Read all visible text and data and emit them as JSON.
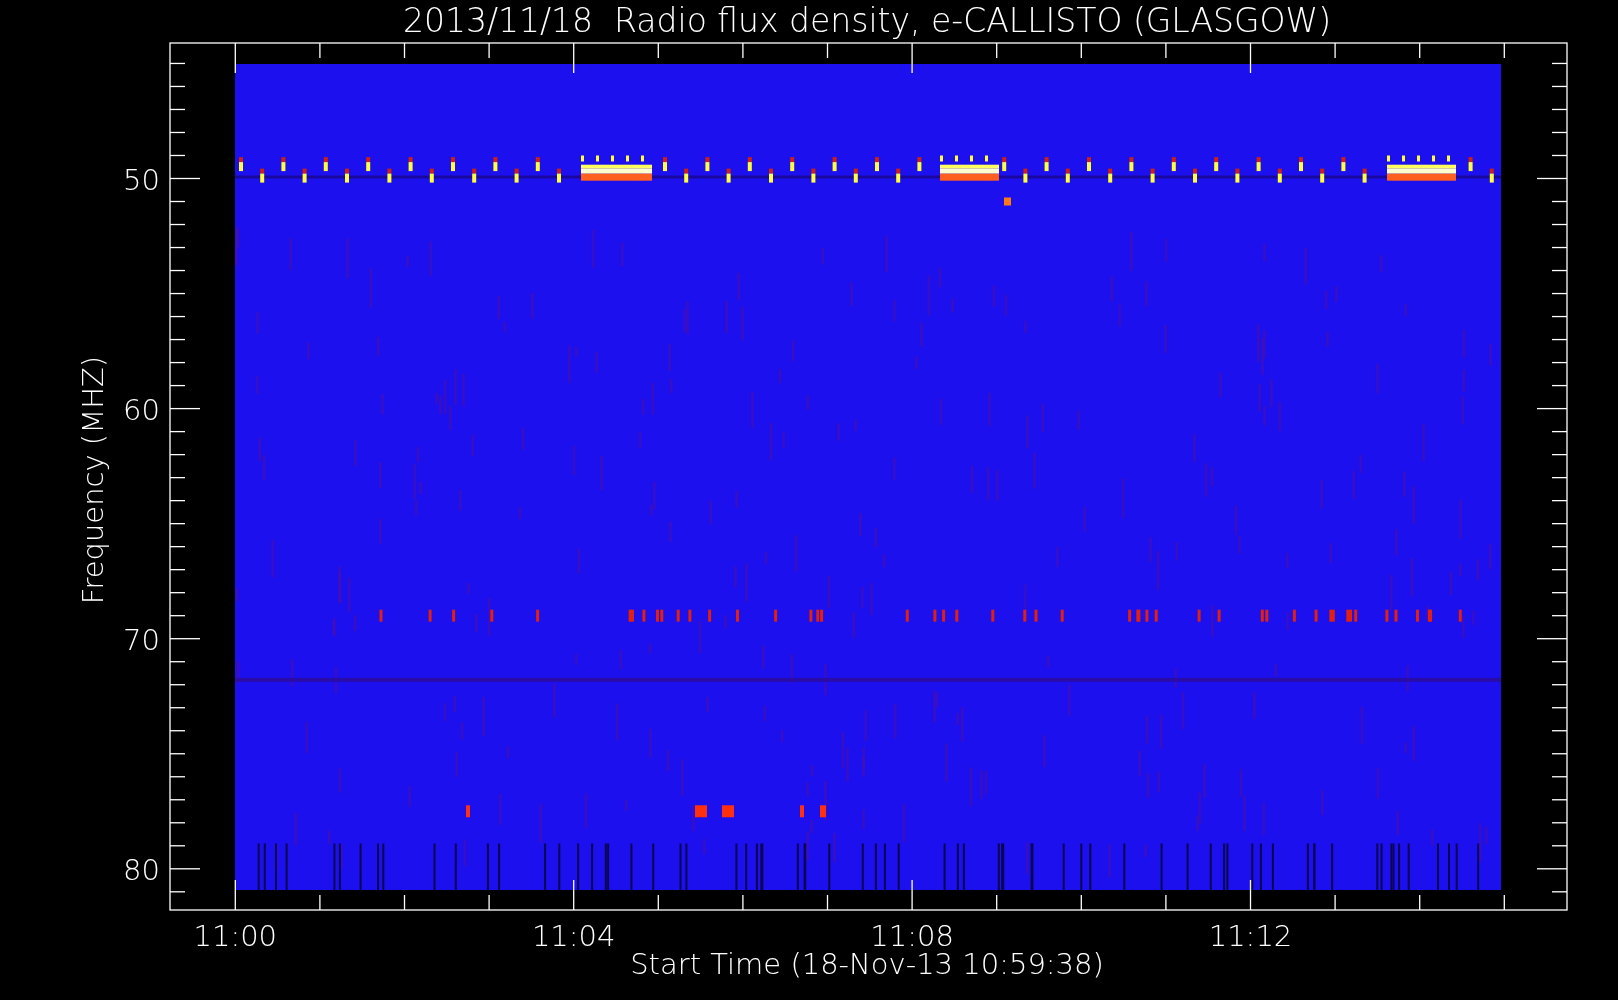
{
  "plot": {
    "title": "2013/11/18  Radio flux density, e-CALLISTO (GLASGOW)",
    "xlabel": "Start Time (18-Nov-13 10:59:38)",
    "ylabel": "Frequency (MHZ)",
    "xtick_labels": [
      "11:00",
      "11:04",
      "11:08",
      "11:12"
    ],
    "ytick_labels": [
      "50",
      "60",
      "70",
      "80"
    ]
  }
}
